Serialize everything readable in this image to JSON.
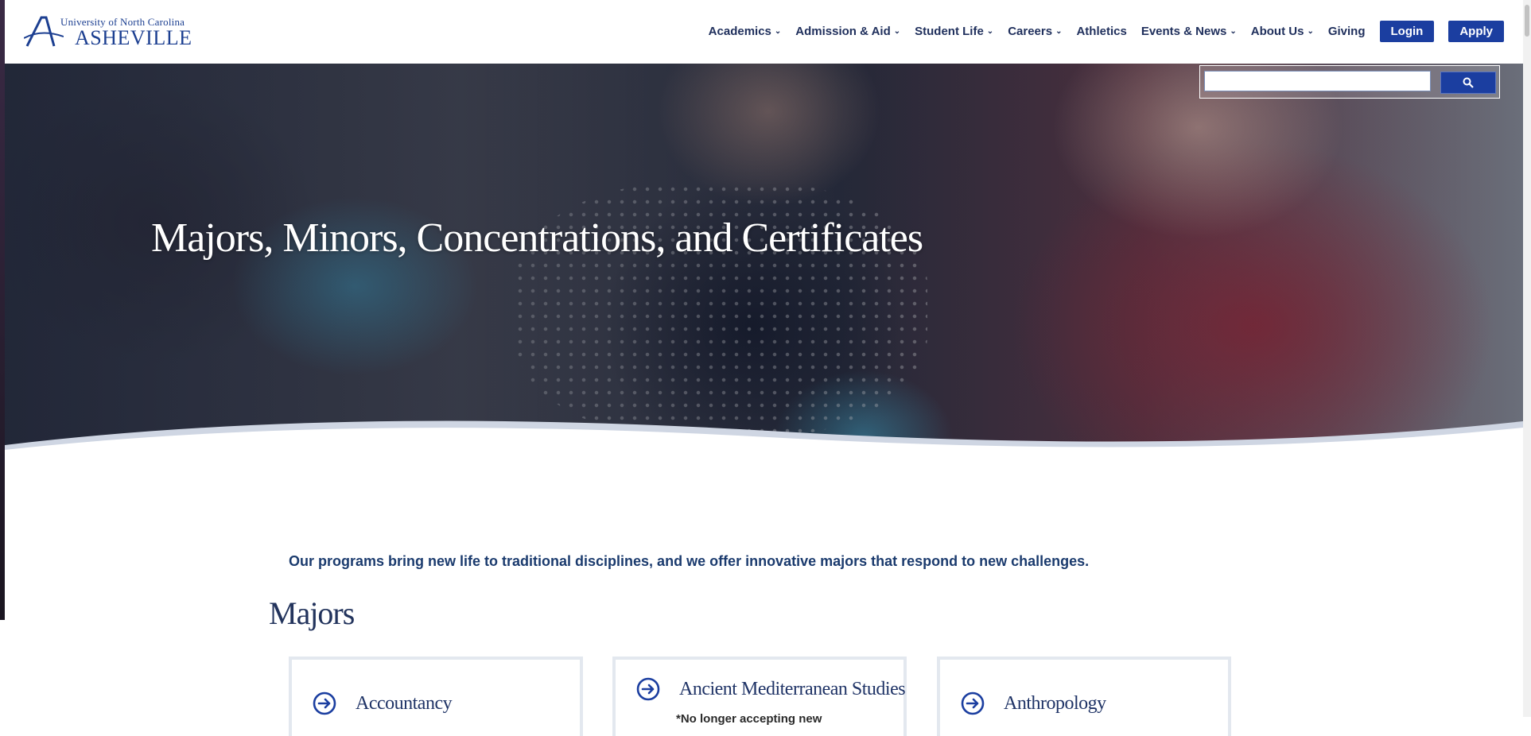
{
  "header": {
    "logo_top": "University of North Carolina",
    "logo_main": "ASHEVILLE",
    "nav": [
      {
        "label": "Academics",
        "has_dropdown": true
      },
      {
        "label": "Admission & Aid",
        "has_dropdown": true
      },
      {
        "label": "Student Life",
        "has_dropdown": true
      },
      {
        "label": "Careers",
        "has_dropdown": true
      },
      {
        "label": "Athletics",
        "has_dropdown": false
      },
      {
        "label": "Events & News",
        "has_dropdown": true
      },
      {
        "label": "About Us",
        "has_dropdown": true
      },
      {
        "label": "Giving",
        "has_dropdown": false
      }
    ],
    "login_label": "Login",
    "apply_label": "Apply"
  },
  "search": {
    "value": "",
    "button_icon": "search-icon"
  },
  "hero": {
    "title": "Majors, Minors, Concentrations, and Certificates"
  },
  "intro": "Our programs bring new life to traditional disciplines, and we offer innovative majors that respond to new challenges.",
  "majors": {
    "heading": "Majors",
    "cards": [
      {
        "label": "Accountancy",
        "note": ""
      },
      {
        "label": "Ancient Mediterranean Studies",
        "note": "*No longer accepting new"
      },
      {
        "label": "Anthropology",
        "note": ""
      }
    ]
  },
  "colors": {
    "brand_blue": "#1b3ea0",
    "nav_text": "#1f2f5c",
    "heading_text": "#22335c",
    "card_border": "#e3e8ef"
  }
}
